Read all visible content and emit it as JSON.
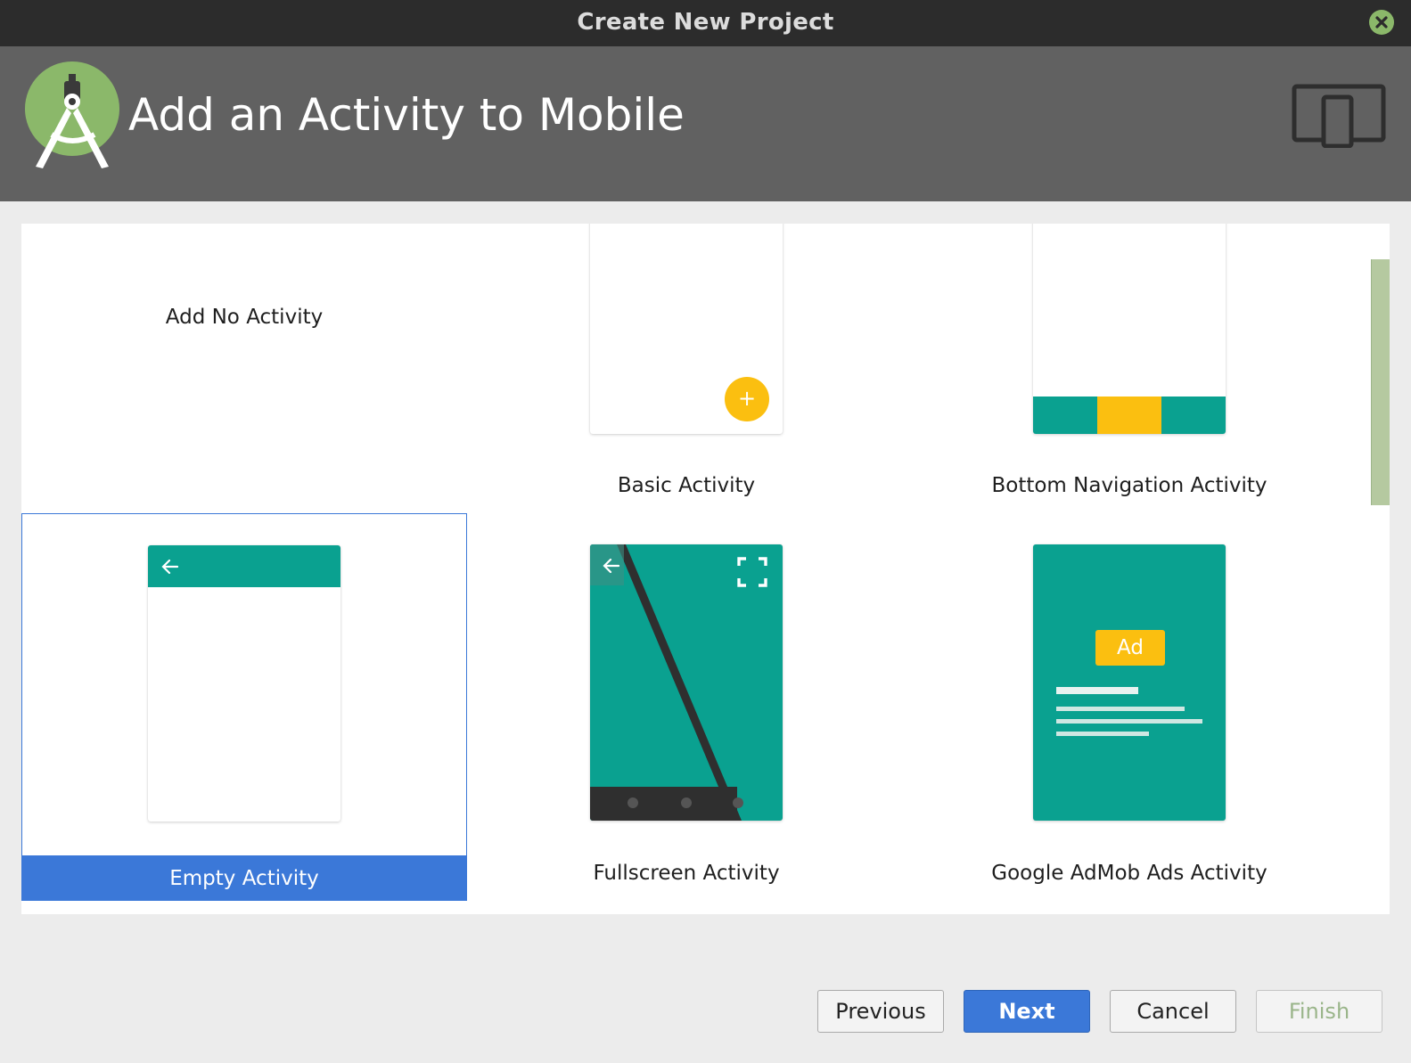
{
  "window": {
    "title": "Create New Project"
  },
  "header": {
    "title": "Add an Activity to Mobile"
  },
  "icons": {
    "close": "close-icon",
    "logo": "android-studio-logo",
    "device": "phone-tablet-icon",
    "back_arrow": "back-arrow-icon",
    "fullscreen": "fullscreen-icon",
    "fab_plus": "plus-icon"
  },
  "colors": {
    "teal": "#0aa190",
    "amber": "#fbbf10",
    "selection": "#3b78d8",
    "header_bg": "#616161",
    "titlebar_bg": "#2c2c2c",
    "close_green": "#8bb86a"
  },
  "gallery": {
    "tiles": [
      {
        "label": "Add No Activity",
        "selected": false
      },
      {
        "label": "Basic Activity",
        "selected": false
      },
      {
        "label": "Bottom Navigation Activity",
        "selected": false
      },
      {
        "label": "Empty Activity",
        "selected": true
      },
      {
        "label": "Fullscreen Activity",
        "selected": false
      },
      {
        "label": "Google AdMob Ads Activity",
        "selected": false
      }
    ],
    "basic_fab": "+",
    "admob_badge": "Ad"
  },
  "buttons": {
    "previous": "Previous",
    "next": "Next",
    "cancel": "Cancel",
    "finish": "Finish"
  }
}
